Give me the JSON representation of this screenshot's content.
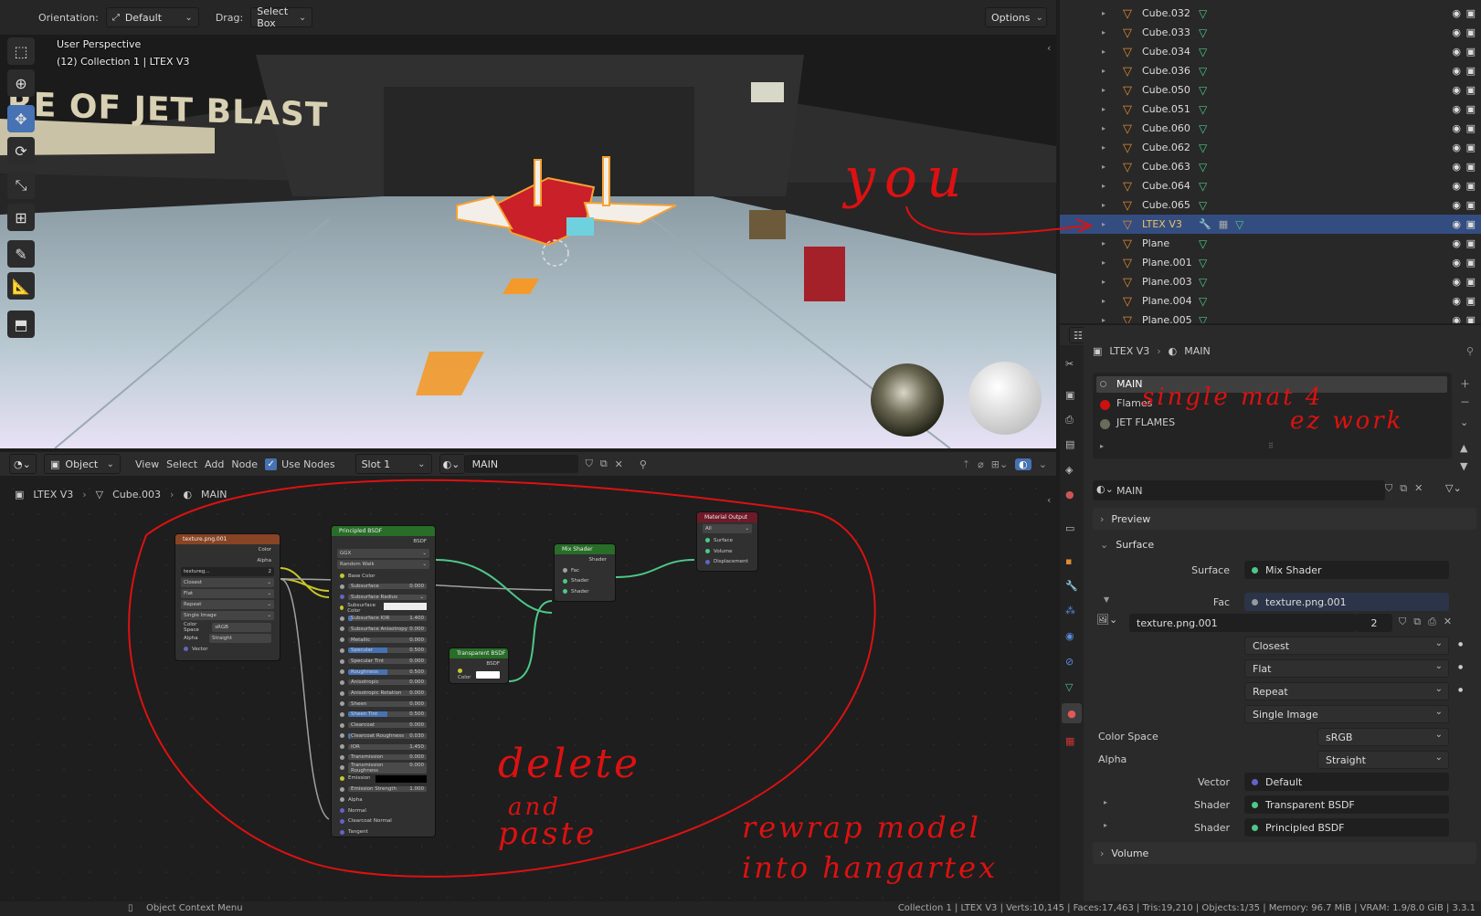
{
  "viewport": {
    "orientation_label": "Orientation:",
    "orientation_value": "Default",
    "drag_label": "Drag:",
    "drag_value": "Select Box",
    "options_label": "Options",
    "perspective": "User Perspective",
    "collection_info": "(12) Collection 1 | LTEX V3",
    "sign_text": "RE OF JET BLAST"
  },
  "outliner": {
    "items": [
      {
        "name": "Cube.032"
      },
      {
        "name": "Cube.033"
      },
      {
        "name": "Cube.034"
      },
      {
        "name": "Cube.036"
      },
      {
        "name": "Cube.050"
      },
      {
        "name": "Cube.051"
      },
      {
        "name": "Cube.060"
      },
      {
        "name": "Cube.062"
      },
      {
        "name": "Cube.063"
      },
      {
        "name": "Cube.064"
      },
      {
        "name": "Cube.065"
      },
      {
        "name": "LTEX V3",
        "selected": true
      },
      {
        "name": "Plane"
      },
      {
        "name": "Plane.001"
      },
      {
        "name": "Plane.003"
      },
      {
        "name": "Plane.004"
      },
      {
        "name": "Plane.005"
      }
    ]
  },
  "node_editor": {
    "header": {
      "mode": "Object",
      "menus": [
        "View",
        "Select",
        "Add",
        "Node"
      ],
      "use_nodes": "Use Nodes",
      "slot": "Slot 1",
      "material": "MAIN"
    },
    "breadcrumb": [
      "LTEX V3",
      "Cube.003",
      "MAIN"
    ],
    "nodes": {
      "image": {
        "title": "texture.png.001",
        "out_color": "Color",
        "out_alpha": "Alpha",
        "img_name": "textureg...",
        "users": "2",
        "interp": "Closest",
        "proj": "Flat",
        "ext": "Repeat",
        "source": "Single Image",
        "cs_label": "Color Space",
        "cs_value": "sRGB",
        "alpha_label": "Alpha",
        "alpha_value": "Straight",
        "vector": "Vector"
      },
      "bsdf": {
        "title": "Principled BSDF",
        "out": "BSDF",
        "dist": "GGX",
        "sss": "Random Walk",
        "base": "Base Color",
        "rows": [
          {
            "label": "Subsurface",
            "value": "0.000"
          },
          {
            "label": "Subsurface Radius",
            "value": ""
          },
          {
            "label": "Subsurface Color",
            "value": ""
          },
          {
            "label": "Subsurface IOR",
            "value": "1.400"
          },
          {
            "label": "Subsurface Anisotropy",
            "value": "0.000"
          },
          {
            "label": "Metallic",
            "value": "0.000"
          },
          {
            "label": "Specular",
            "value": "0.500"
          },
          {
            "label": "Specular Tint",
            "value": "0.000"
          },
          {
            "label": "Roughness",
            "value": "0.500"
          },
          {
            "label": "Anisotropic",
            "value": "0.000"
          },
          {
            "label": "Anisotropic Rotation",
            "value": "0.000"
          },
          {
            "label": "Sheen",
            "value": "0.000"
          },
          {
            "label": "Sheen Tint",
            "value": "0.500"
          },
          {
            "label": "Clearcoat",
            "value": "0.000"
          },
          {
            "label": "Clearcoat Roughness",
            "value": "0.030"
          },
          {
            "label": "IOR",
            "value": "1.450"
          },
          {
            "label": "Transmission",
            "value": "0.000"
          },
          {
            "label": "Transmission Roughness",
            "value": "0.000"
          },
          {
            "label": "Emission",
            "value": ""
          },
          {
            "label": "Emission Strength",
            "value": "1.000"
          }
        ],
        "inputs": [
          "Alpha",
          "Normal",
          "Clearcoat Normal",
          "Tangent"
        ]
      },
      "transparent": {
        "title": "Transparent BSDF",
        "out": "BSDF",
        "color": "Color"
      },
      "mix": {
        "title": "Mix Shader",
        "out": "Shader",
        "fac": "Fac",
        "s1": "Shader",
        "s2": "Shader"
      },
      "output": {
        "title": "Material Output",
        "target": "All",
        "surface": "Surface",
        "volume": "Volume",
        "disp": "Displacement"
      }
    }
  },
  "properties": {
    "breadcrumb": [
      "LTEX V3",
      "MAIN"
    ],
    "slots": [
      {
        "name": "MAIN",
        "color": "#3a3a3a"
      },
      {
        "name": "Flames",
        "color": "#cc1111"
      },
      {
        "name": "JET FLAMES",
        "color": "#6b6b5a"
      }
    ],
    "material_name": "MAIN",
    "preview": "Preview",
    "surface_panel": "Surface",
    "surface_label": "Surface",
    "surface_value": "Mix Shader",
    "fac_label": "Fac",
    "fac_value": "texture.png.001",
    "image_name": "texture.png.001",
    "image_users": "2",
    "interp": "Closest",
    "projection": "Flat",
    "extension": "Repeat",
    "source": "Single Image",
    "colorspace_label": "Color Space",
    "colorspace_value": "sRGB",
    "alpha_label": "Alpha",
    "alpha_value": "Straight",
    "vector_label": "Vector",
    "vector_value": "Default",
    "shader1_label": "Shader",
    "shader1_value": "Transparent BSDF",
    "shader2_label": "Shader",
    "shader2_value": "Principled BSDF",
    "volume": "Volume"
  },
  "annotations": {
    "you": "you",
    "single_mat": "single mat 4",
    "ez_work": "ez work",
    "delete": "delete",
    "and": "and",
    "paste": "paste",
    "rewrap1": "rewrap model",
    "rewrap2": "into hangartex"
  },
  "status": {
    "context_menu": "Object Context Menu",
    "stats": "Collection 1 | LTEX V3 | Verts:10,145 | Faces:17,463 | Tris:19,210 | Objects:1/35 | Memory: 96.7 MiB | VRAM: 1.9/8.0 GiB | 3.3.1"
  }
}
